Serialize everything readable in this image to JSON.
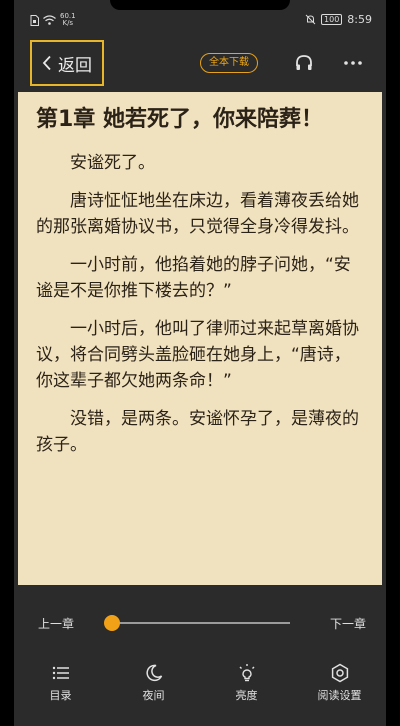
{
  "status_bar": {
    "network_speed_value": "60.1",
    "network_speed_unit": "K/s",
    "battery": "100",
    "time": "8:59"
  },
  "topbar": {
    "back_label": "返回",
    "download_label": "全本下载"
  },
  "content": {
    "chapter_title": "第1章  她若死了，你来陪葬！",
    "paragraphs": [
      "安谧死了。",
      "唐诗怔怔地坐在床边，看着薄夜丢给她的那张离婚协议书，只觉得全身冷得发抖。",
      "一小时前，他掐着她的脖子问她，“安谧是不是你推下楼去的？”",
      "一小时后，他叫了律师过来起草离婚协议，将合同劈头盖脸砸在她身上，“唐诗，你这辈子都欠她两条命！”",
      "没错，是两条。安谧怀孕了，是薄夜的孩子。"
    ]
  },
  "controls": {
    "prev_chapter": "上一章",
    "next_chapter": "下一章",
    "progress": 0.03
  },
  "nav": [
    {
      "label": "目录",
      "icon": "list-icon"
    },
    {
      "label": "夜间",
      "icon": "moon-icon"
    },
    {
      "label": "亮度",
      "icon": "brightness-icon"
    },
    {
      "label": "阅读设置",
      "icon": "gear-icon"
    }
  ],
  "colors": {
    "accent": "#f1a117",
    "highlight_border": "#e6b52a",
    "page_background": "#f1e2bf",
    "panel_background": "#2b2b2b"
  }
}
